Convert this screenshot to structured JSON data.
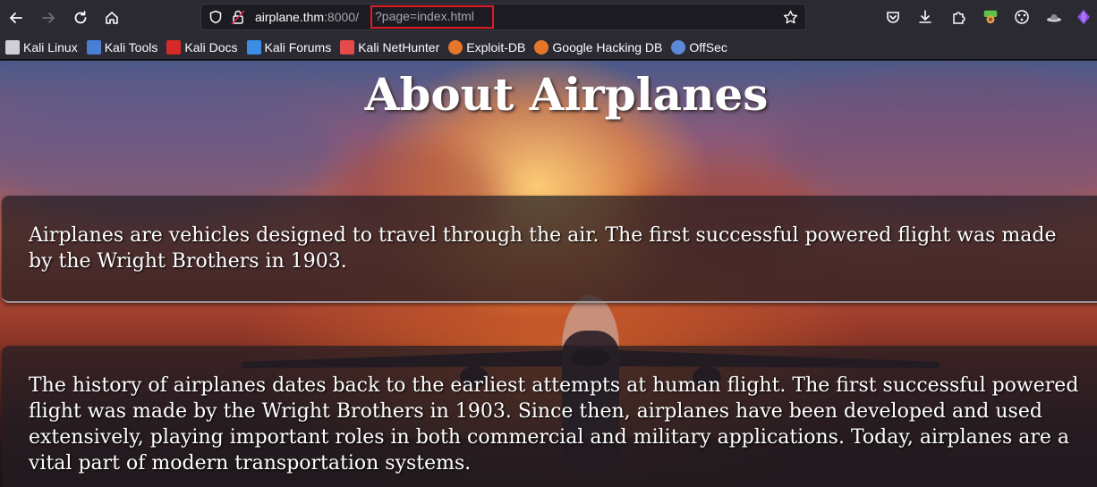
{
  "browser": {
    "url_host": "airplane.thm",
    "url_port": ":8000/",
    "url_query": "?page=index.html"
  },
  "bookmarks": [
    {
      "label": "Kali Linux",
      "icon": "kali-dragon-icon",
      "color": "#cfcfd6"
    },
    {
      "label": "Kali Tools",
      "icon": "kali-tools-icon",
      "color": "#4a7fd6"
    },
    {
      "label": "Kali Docs",
      "icon": "kali-docs-icon",
      "color": "#d42a2a"
    },
    {
      "label": "Kali Forums",
      "icon": "kali-forums-icon",
      "color": "#3a8ee6"
    },
    {
      "label": "Kali NetHunter",
      "icon": "kali-nethunter-icon",
      "color": "#e64a4a"
    },
    {
      "label": "Exploit-DB",
      "icon": "exploit-db-icon",
      "color": "#e8762a"
    },
    {
      "label": "Google Hacking DB",
      "icon": "ghdb-icon",
      "color": "#e8762a"
    },
    {
      "label": "OffSec",
      "icon": "offsec-icon",
      "color": "#5a8ad6"
    }
  ],
  "page": {
    "title": "About Airplanes",
    "card1": "Airplanes are vehicles designed to travel through the air. The first successful powered flight was made by the Wright Brothers in 1903.",
    "card2": "The history of airplanes dates back to the earliest attempts at human flight. The first successful powered flight was made by the Wright Brothers in 1903. Since then, airplanes have been developed and used extensively, playing important roles in both commercial and military applications. Today, airplanes are a vital part of modern transportation systems."
  },
  "colors": {
    "toolbar_bg": "#2b2a33",
    "highlight_box": "#e01b24"
  }
}
